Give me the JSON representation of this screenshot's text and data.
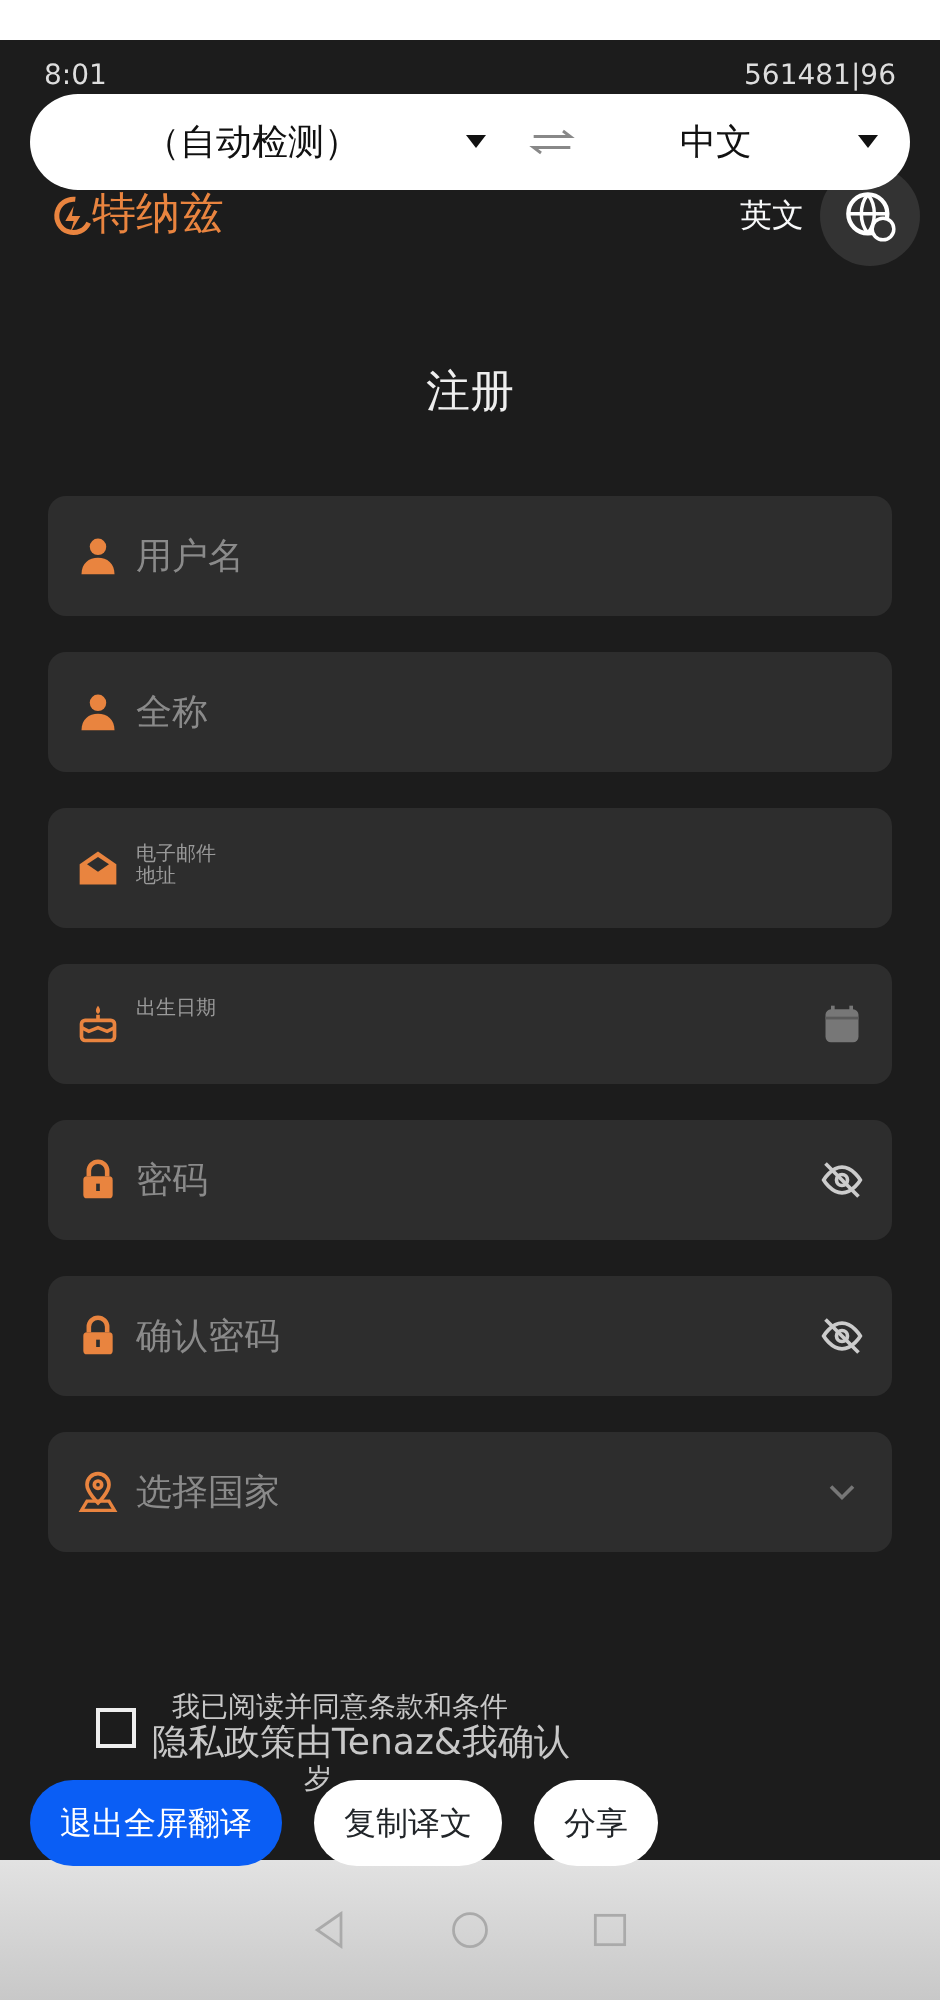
{
  "status_bar": {
    "time": "8:01",
    "right_text": "561481|96"
  },
  "translate_bar": {
    "source": "（自动检测）",
    "target": "中文"
  },
  "header": {
    "logo": "特纳兹",
    "language": "英文"
  },
  "title": "注册",
  "fields": [
    {
      "kind": "text",
      "placeholder": "用户名"
    },
    {
      "kind": "text",
      "placeholder": "全称"
    },
    {
      "kind": "floating",
      "label_lines": [
        "电子邮件",
        "地址"
      ]
    },
    {
      "kind": "floating",
      "label_lines": [
        "出生日期"
      ]
    },
    {
      "kind": "text",
      "placeholder": "密码"
    },
    {
      "kind": "text",
      "placeholder": "确认密码"
    },
    {
      "kind": "select",
      "placeholder": "选择国家"
    }
  ],
  "terms": {
    "checked": false,
    "lines": [
      "我已阅读并同意条款和条件",
      "隐私政策由Tenaz&我确认",
      "岁"
    ]
  },
  "actions": [
    {
      "label": "退出全屏翻译",
      "primary": true
    },
    {
      "label": "复制译文",
      "primary": false
    },
    {
      "label": "分享",
      "primary": false
    }
  ]
}
